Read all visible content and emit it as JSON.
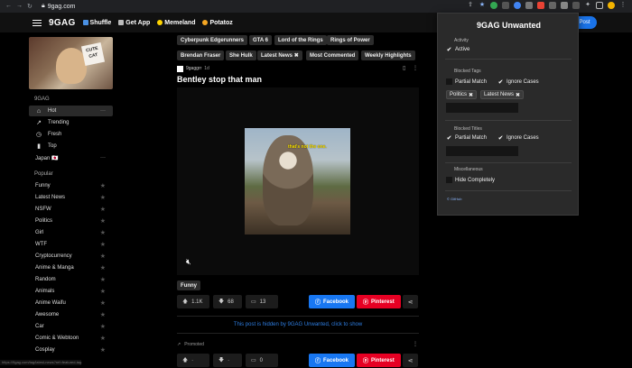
{
  "browser": {
    "url": "9gag.com"
  },
  "topbar": {
    "logo": "9GAG",
    "links": [
      {
        "label": "Shuffle",
        "icon": "shuffle-icon",
        "color": "#4a90e2"
      },
      {
        "label": "Get App",
        "icon": "phone-icon",
        "color": "#bbbbbb"
      },
      {
        "label": "Memeland",
        "icon": "memeland-icon",
        "color": "#ffd400"
      },
      {
        "label": "Potatoz",
        "icon": "potato-icon",
        "color": "#f5a623"
      }
    ],
    "post_button": "Post"
  },
  "sidebar": {
    "banner_text": "CUTE CAT",
    "section_title": "9GAG",
    "nav": [
      {
        "label": "Hot",
        "icon": "home-icon"
      },
      {
        "label": "Trending",
        "icon": "trending-icon"
      },
      {
        "label": "Fresh",
        "icon": "clock-icon"
      },
      {
        "label": "Top",
        "icon": "bar-chart-icon"
      },
      {
        "label": "Japan 🇯🇵",
        "icon": ""
      }
    ],
    "popular_title": "Popular",
    "popular": [
      "Funny",
      "Latest News",
      "NSFW",
      "Politics",
      "Girl",
      "WTF",
      "Cryptocurrency",
      "Anime & Manga",
      "Random",
      "Animals",
      "Anime Waifu",
      "Awesome",
      "Car",
      "Comic & Webtoon",
      "Cosplay"
    ]
  },
  "main": {
    "tags_row1": [
      "Cyberpunk Edgerunners",
      "GTA 6",
      "Lord of the Rings",
      "Rings of Power"
    ],
    "tags_row2": [
      "Brendan Fraser",
      "She Hulk",
      "Latest News",
      "Most Commented",
      "Weekly Highlights"
    ],
    "post": {
      "author": "9gaggrr",
      "time": "1d",
      "title": "Bentley stop that man",
      "caption": "that's not the one.",
      "chip": "Funny",
      "upvotes": "1.1K",
      "downvotes": "68",
      "comments": "13",
      "facebook": "Facebook",
      "pinterest": "Pinterest"
    },
    "hidden_note": "This post is hidden by 9GAG Unwanted, click to show",
    "promoted": {
      "label": "Promoted",
      "upvotes": "·",
      "downvotes": "·",
      "comments": "0",
      "facebook": "Facebook",
      "pinterest": "Pinterest"
    }
  },
  "popup": {
    "title": "9GAG Unwanted",
    "activity_label": "Activity",
    "active_label": "Active",
    "blocked_tags_label": "Blocked Tags",
    "partial_match_label": "Partial Match",
    "ignore_cases_label": "Ignore Cases",
    "blocked_tags": [
      "Politics",
      "Latest News"
    ],
    "blocked_titles_label": "Blocked Titles",
    "titles_partial_match_label": "Partial Match",
    "titles_ignore_cases_label": "Ignore Cases",
    "misc_label": "Miscellaneous",
    "hide_completely_label": "Hide Completely",
    "github_link": "© GitHub"
  },
  "statusbar": "https://9gag.com/tag/latest-news?ref=featured-tag"
}
